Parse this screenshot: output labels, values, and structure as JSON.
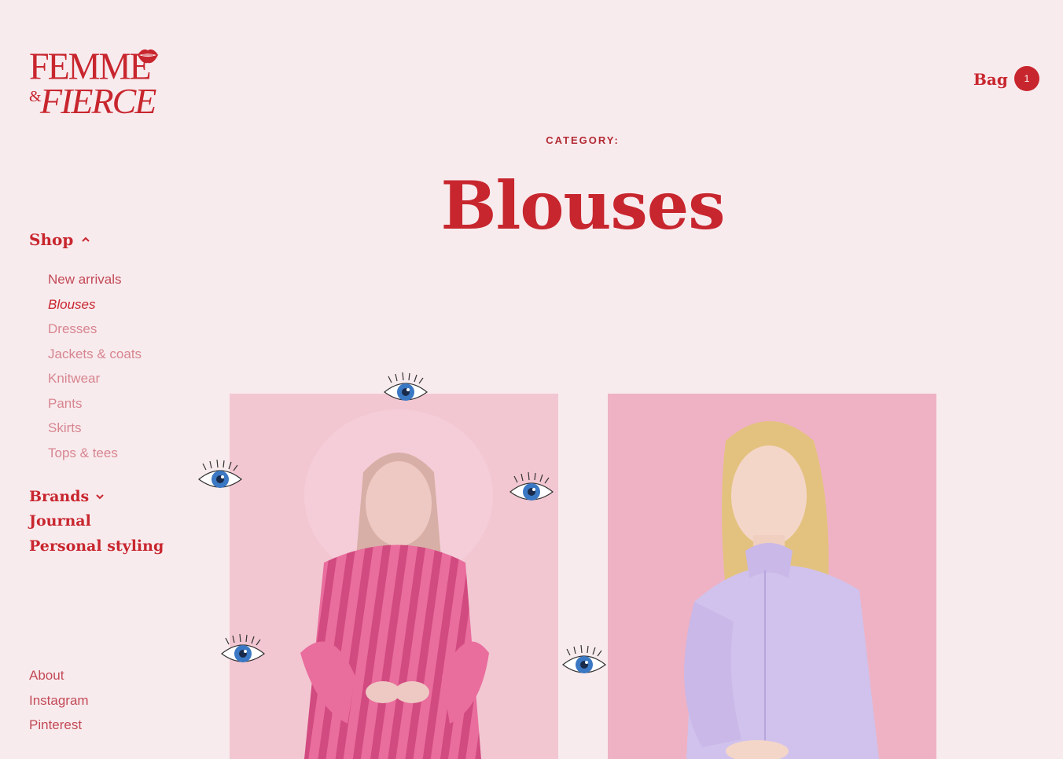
{
  "brand": {
    "line1": "FEMME",
    "amp": "&",
    "line2": "FIERCE"
  },
  "header": {
    "bag_label": "Bag",
    "bag_count": "1"
  },
  "category": {
    "label": "CATEGORY:",
    "title": "Blouses"
  },
  "sidebar": {
    "shop_label": "Shop",
    "sub_items": [
      {
        "label": "New arrivals"
      },
      {
        "label": "Blouses"
      },
      {
        "label": "Dresses"
      },
      {
        "label": "Jackets & coats"
      },
      {
        "label": "Knitwear"
      },
      {
        "label": "Pants"
      },
      {
        "label": "Skirts"
      },
      {
        "label": "Tops & tees"
      }
    ],
    "main_items": [
      {
        "label": "Brands"
      },
      {
        "label": "Journal"
      },
      {
        "label": "Personal styling"
      }
    ],
    "footer_items": [
      {
        "label": "About"
      },
      {
        "label": "Instagram"
      },
      {
        "label": "Pinterest"
      }
    ]
  },
  "products": [
    {
      "image": "model in pink striped blouse"
    },
    {
      "image": "model in lavender ruffle blouse"
    }
  ],
  "colors": {
    "accent": "#c8262e",
    "background": "#f8ebee",
    "muted": "#d7858f",
    "eye_iris": "#3b78c4"
  }
}
